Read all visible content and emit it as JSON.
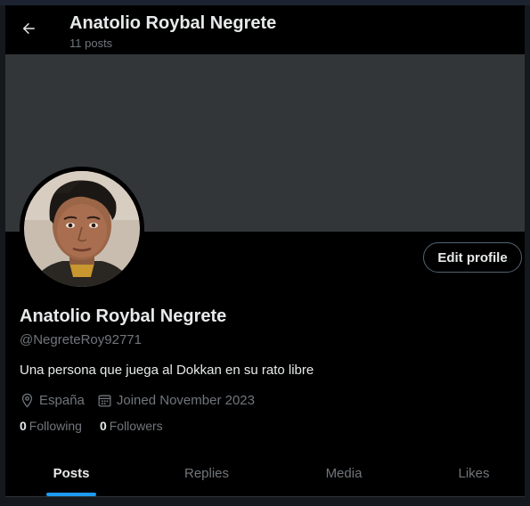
{
  "header": {
    "back_icon": "arrow-left-icon",
    "title": "Anatolio Roybal Negrete",
    "subtitle": "11 posts"
  },
  "profile": {
    "display_name": "Anatolio Roybal Negrete",
    "handle": "@NegreteRoy92771",
    "bio": "Una persona que juega al Dokkan en su rato libre",
    "location": "España",
    "joined": "Joined November 2023",
    "following_count": "0",
    "following_label": "Following",
    "followers_count": "0",
    "followers_label": "Followers",
    "edit_label": "Edit profile"
  },
  "tabs": [
    {
      "label": "Posts",
      "active": true
    },
    {
      "label": "Replies",
      "active": false
    },
    {
      "label": "Media",
      "active": false
    },
    {
      "label": "Likes",
      "active": false
    }
  ],
  "colors": {
    "background": "#000000",
    "banner": "#333639",
    "accent": "#1d9bf0",
    "secondary_text": "#71767b",
    "primary_text": "#e7e9ea"
  }
}
